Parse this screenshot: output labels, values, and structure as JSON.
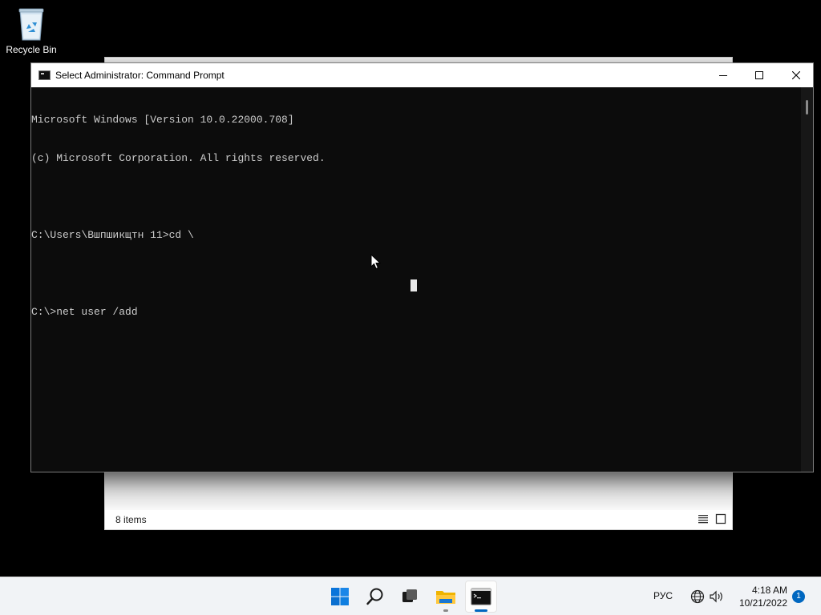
{
  "desktop": {
    "icons": [
      {
        "label": "Recycle Bin",
        "icon": "recycle-bin-icon"
      }
    ]
  },
  "explorer": {
    "status_items": "8 items",
    "view_buttons": [
      "details-view-icon",
      "tiles-view-icon"
    ]
  },
  "cmd": {
    "title": "Select Administrator: Command Prompt",
    "lines": [
      "Microsoft Windows [Version 10.0.22000.708]",
      "(c) Microsoft Corporation. All rights reserved.",
      "",
      "C:\\Users\\Вшпшикщтн 11>cd \\",
      "",
      "C:\\>net user /add"
    ],
    "colors": {
      "background": "#0c0c0c",
      "text": "#cccccc",
      "titlebar": "#ffffff"
    }
  },
  "taskbar": {
    "apps": [
      "start-icon",
      "search-icon",
      "task-view-icon",
      "file-explorer-icon",
      "command-prompt-icon"
    ],
    "active_app": "command-prompt-icon",
    "tray": {
      "language": "РУС",
      "time": "4:18 AM",
      "date": "10/21/2022",
      "notification_count": "1"
    },
    "colors": {
      "background": "#f1f3f6",
      "accent": "#0067c0"
    }
  }
}
